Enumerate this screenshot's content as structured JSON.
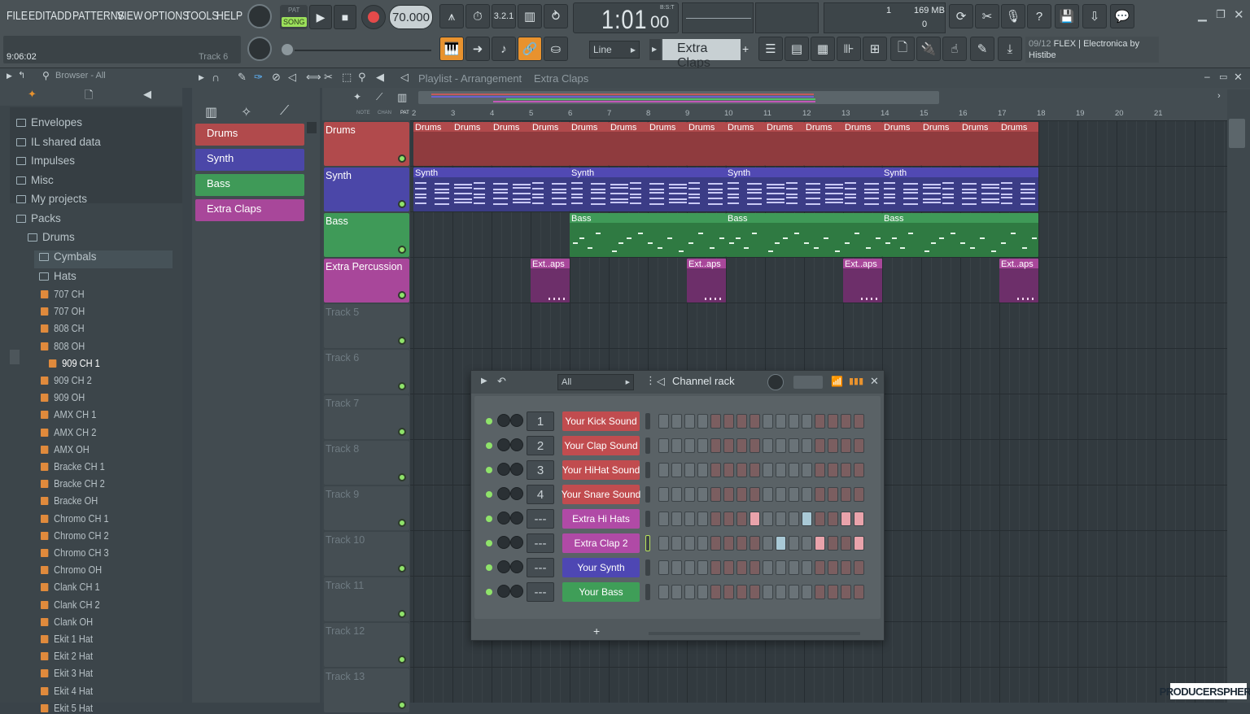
{
  "menu": [
    "FILE",
    "EDIT",
    "ADD",
    "PATTERNS",
    "VIEW",
    "OPTIONS",
    "TOOLS",
    "HELP"
  ],
  "transport": {
    "pat_label": "PAT",
    "song_label": "SONG",
    "tempo": "70.000",
    "time": "1:01",
    "time_small": "00",
    "bst": "B:S:T"
  },
  "hint": {
    "time": "9:06:02",
    "track": "Track 6"
  },
  "cpu": {
    "voices": "1",
    "memory": "169 MB",
    "zero": "0"
  },
  "snap": {
    "mode": "Line",
    "pattern": "Extra Claps"
  },
  "news": {
    "counter": "09/12",
    "text": "FLEX | Electronica by",
    "author": "Histibe"
  },
  "browser": {
    "title": "Browser - All",
    "folders": [
      {
        "label": "Envelopes"
      },
      {
        "label": "IL shared data"
      },
      {
        "label": "Impulses"
      },
      {
        "label": "Misc"
      },
      {
        "label": "My projects"
      },
      {
        "label": "Packs"
      },
      {
        "label": "Drums"
      },
      {
        "label": "Cymbals"
      },
      {
        "label": "Hats"
      }
    ],
    "files": [
      "707 CH",
      "707 OH",
      "808 CH",
      "808 OH",
      "909 CH 1",
      "909 CH 2",
      "909 OH",
      "AMX CH 1",
      "AMX CH 2",
      "AMX OH",
      "Bracke CH 1",
      "Bracke CH 2",
      "Bracke OH",
      "Chromo CH 1",
      "Chromo CH 2",
      "Chromo CH 3",
      "Chromo OH",
      "Clank CH 1",
      "Clank CH 2",
      "Clank OH",
      "Ekit 1 Hat",
      "Ekit 2 Hat",
      "Ekit 3 Hat",
      "Ekit 4 Hat",
      "Ekit 5 Hat"
    ]
  },
  "patterns": [
    {
      "label": "Drums",
      "color": "#b14a4c"
    },
    {
      "label": "Synth",
      "color": "#4b47a8"
    },
    {
      "label": "Bass",
      "color": "#3f9a58"
    },
    {
      "label": "Extra Claps",
      "color": "#a8479a"
    }
  ],
  "playlist": {
    "title": "Playlist - Arrangement",
    "pattern": "Extra Claps",
    "ruler": [
      "2",
      "3",
      "4",
      "5",
      "6",
      "7",
      "8",
      "9",
      "10",
      "11",
      "12",
      "13",
      "14",
      "15",
      "16",
      "17",
      "18",
      "19",
      "20",
      "21"
    ],
    "tracks": [
      {
        "label": "Drums",
        "color": "#b14a4c"
      },
      {
        "label": "Synth",
        "color": "#4b47a8"
      },
      {
        "label": "Bass",
        "color": "#3f9a58"
      },
      {
        "label": "Extra Percussion",
        "color": "#a8479a"
      },
      {
        "label": "Track 5"
      },
      {
        "label": "Track 6"
      },
      {
        "label": "Track 7"
      },
      {
        "label": "Track 8"
      },
      {
        "label": "Track 9"
      },
      {
        "label": "Track 10"
      },
      {
        "label": "Track 11"
      },
      {
        "label": "Track 12"
      },
      {
        "label": "Track 13"
      }
    ],
    "clip_labels": {
      "drums": "Drums",
      "synth": "Synth",
      "bass": "Bass",
      "claps": "Ext..aps"
    }
  },
  "channel_rack": {
    "filter": "All",
    "title": "Channel rack",
    "add": "+",
    "channels": [
      {
        "num": "1",
        "name": "Your Kick Sound",
        "color": "#c14c4f"
      },
      {
        "num": "2",
        "name": "Your Clap Sound",
        "color": "#c14c4f"
      },
      {
        "num": "3",
        "name": "Your HiHat Sound",
        "color": "#c14c4f"
      },
      {
        "num": "4",
        "name": "Your Snare Sound",
        "color": "#c14c4f"
      },
      {
        "num": "---",
        "name": "Extra Hi Hats",
        "color": "#b04aa6"
      },
      {
        "num": "---",
        "name": "Extra Clap 2",
        "color": "#b04aa6"
      },
      {
        "num": "---",
        "name": "Your Synth",
        "color": "#4e47b3"
      },
      {
        "num": "---",
        "name": "Your Bass",
        "color": "#3f9e58"
      }
    ]
  },
  "watermark": "PRODUCERSPHERE"
}
